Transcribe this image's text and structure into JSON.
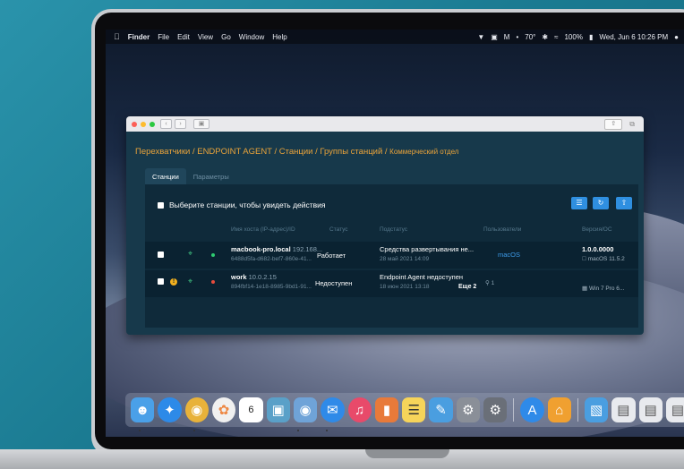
{
  "menubar": {
    "apple": "",
    "app": "Finder",
    "items": [
      "File",
      "Edit",
      "View",
      "Go",
      "Window",
      "Help"
    ],
    "temperature": "70°",
    "battery": "100%",
    "datetime": "Wed, Jun 6  10:26 PM"
  },
  "breadcrumb": {
    "parts": [
      "Перехватчики",
      "ENDPOINT AGENT",
      "Станции",
      "Группы станций"
    ],
    "current": "Коммерческий отдел",
    "separator": "/"
  },
  "tabs": [
    {
      "label": "Станции",
      "active": true
    },
    {
      "label": "Параметры",
      "active": false
    }
  ],
  "panel": {
    "select_label": "Выберите станции, чтобы увидеть действия"
  },
  "columns": [
    "Имя хоста (IP-адрес)/ID",
    "Статус",
    "Подстатус",
    "Пользователи",
    "Версия/ОС"
  ],
  "rows": [
    {
      "host": "macbook-pro.local",
      "ip": "192.168...",
      "id": "6488d5fa-d682-bef7-860e-41...",
      "status": "Работает",
      "substatus": "Средства развертывания не...",
      "date": "28 май 2021 14:09",
      "users": "macOS",
      "version": "1.0.0.0000",
      "os": "macOS 11.5.2"
    },
    {
      "host": "work",
      "ip": "10.0.2.15",
      "id": "894fbf14-1e18-8985-9bd1-91...",
      "status": "Недоступен",
      "substatus": "Endpoint Agent недоступен",
      "date": "18 июн 2021 13:18",
      "more": "Еще 2",
      "users": "1",
      "version": "",
      "os": "Win 7 Pro 6..."
    }
  ],
  "colors": {
    "accent": "#2f8fe0",
    "breadcrumb": "#e9a33a",
    "online": "#2ecc71",
    "offline": "#e74c3c",
    "warning": "#f2b01e"
  }
}
